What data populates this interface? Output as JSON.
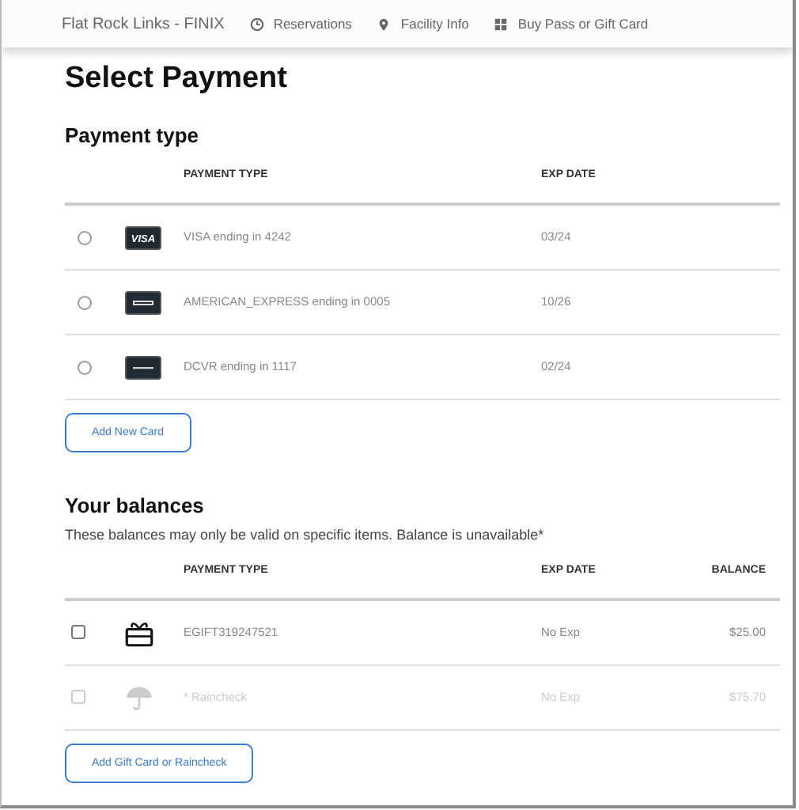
{
  "navbar": {
    "brand": "Flat Rock Links - FINIX",
    "links": [
      {
        "label": "Reservations"
      },
      {
        "label": "Facility Info"
      },
      {
        "label": "Buy Pass or Gift Card"
      }
    ]
  },
  "title": "Select Payment",
  "payment_section": {
    "heading": "Payment type",
    "columns": [
      "PAYMENT TYPE",
      "EXP DATE"
    ],
    "rows": [
      {
        "kind": "visa",
        "logo_text": "VISA",
        "label": "VISA ending in 4242",
        "exp": "03/24",
        "selected": false
      },
      {
        "kind": "amex",
        "label": "AMERICAN_EXPRESS ending in 0005",
        "exp": "10/26",
        "selected": false
      },
      {
        "kind": "discover",
        "label": "DCVR ending in 1117",
        "exp": "02/24",
        "selected": false
      }
    ],
    "button": "Add New Card"
  },
  "balances_section": {
    "heading": "Your balances",
    "note": "These balances may only be valid on specific items. Balance is unavailable*",
    "columns": [
      "PAYMENT TYPE",
      "EXP DATE",
      "BALANCE"
    ],
    "rows": [
      {
        "kind": "giftcard",
        "label": "EGIFT319247521",
        "exp": "No Exp",
        "balance": "$25.00",
        "checked": false,
        "disabled": false
      },
      {
        "kind": "raincheck",
        "label": "* Raincheck",
        "exp": "No Exp",
        "balance": "$75.70",
        "checked": false,
        "disabled": true
      }
    ],
    "button": "Add Gift Card or Raincheck"
  }
}
